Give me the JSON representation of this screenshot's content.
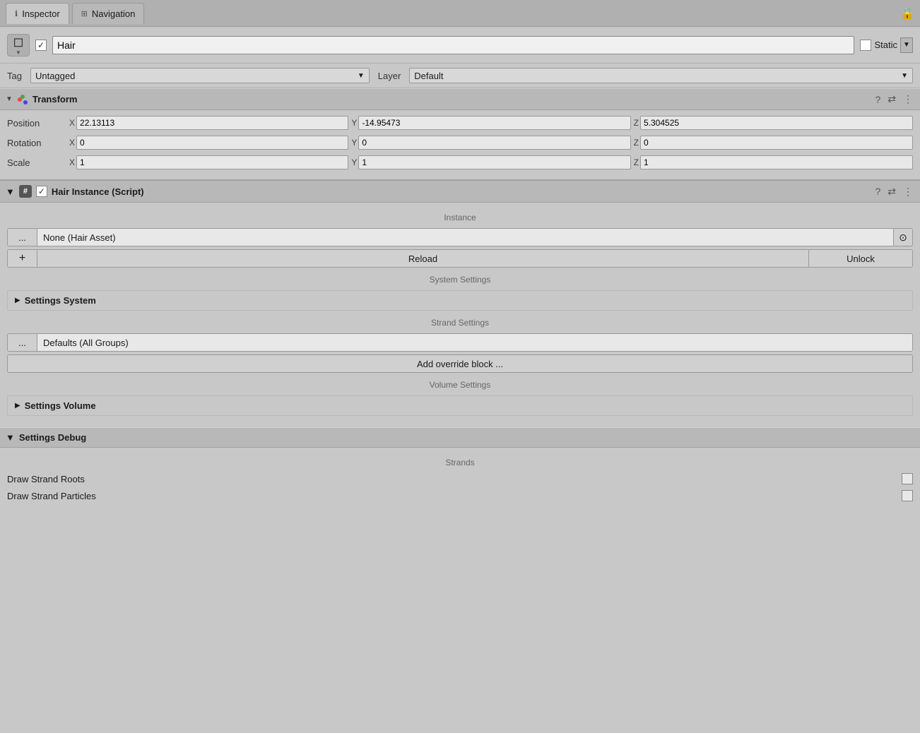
{
  "tabs": {
    "inspector": {
      "label": "Inspector",
      "icon": "ℹ"
    },
    "navigation": {
      "label": "Navigation",
      "icon": "⊞"
    }
  },
  "lock_icon": "🔒",
  "object": {
    "name": "Hair",
    "active_checked": true,
    "static_label": "Static",
    "tag_label": "Tag",
    "tag_value": "Untagged",
    "layer_label": "Layer",
    "layer_value": "Default"
  },
  "transform": {
    "section_title": "Transform",
    "position_label": "Position",
    "position_x": "22.13113",
    "position_y": "-14.95473",
    "position_z": "5.304525",
    "rotation_label": "Rotation",
    "rotation_x": "0",
    "rotation_y": "0",
    "rotation_z": "0",
    "scale_label": "Scale",
    "scale_x": "1",
    "scale_y": "1",
    "scale_z": "1"
  },
  "hair_script": {
    "section_title": "Hair Instance (Script)",
    "instance_label": "Instance",
    "asset_dots": "...",
    "asset_value": "None (Hair Asset)",
    "asset_circle": "⊙",
    "plus_label": "+",
    "reload_label": "Reload",
    "unlock_label": "Unlock",
    "system_settings_label": "System Settings",
    "settings_system_label": "Settings System",
    "strand_settings_label": "Strand Settings",
    "defaults_dots": "...",
    "defaults_value": "Defaults (All Groups)",
    "add_override_label": "Add override block ...",
    "volume_settings_label": "Volume Settings",
    "settings_volume_label": "Settings Volume"
  },
  "settings_debug": {
    "section_title": "Settings Debug",
    "strands_label": "Strands",
    "draw_strand_roots_label": "Draw Strand Roots",
    "draw_strand_particles_label": "Draw Strand Particles"
  }
}
